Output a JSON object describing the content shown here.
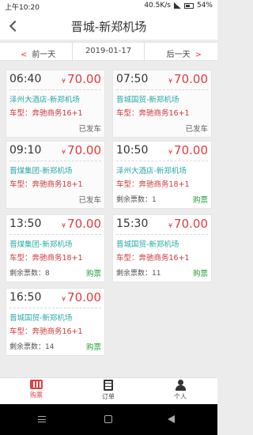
{
  "status_bar": {
    "time": "上午10:20",
    "network_speed": "40.5K/s",
    "battery": "54%"
  },
  "header": {
    "title": "晋城-新郑机场"
  },
  "date_nav": {
    "prev_label": "前一天",
    "current_date": "2019-01-17",
    "next_label": "后一天"
  },
  "trips": [
    {
      "time": "06:40",
      "currency": "¥",
      "price": "70.00",
      "route": "泽州大酒店-新郑机场",
      "model": "车型：奔驰商务16+1",
      "seats": "",
      "action": "已发车",
      "status": "departed"
    },
    {
      "time": "07:50",
      "currency": "¥",
      "price": "70.00",
      "route": "晋城国贸-新郑机场",
      "model": "车型：奔驰商务16+1",
      "seats": "",
      "action": "已发车",
      "status": "departed"
    },
    {
      "time": "09:10",
      "currency": "¥",
      "price": "70.00",
      "route": "晋煤集团-新郑机场",
      "model": "车型：奔驰商务18+1",
      "seats": "",
      "action": "已发车",
      "status": "departed"
    },
    {
      "time": "10:50",
      "currency": "¥",
      "price": "70.00",
      "route": "泽州大酒店-新郑机场",
      "model": "车型：奔驰商务18+1",
      "seats": "剩余票数：1",
      "action": "购票",
      "status": "buy"
    },
    {
      "time": "13:50",
      "currency": "¥",
      "price": "70.00",
      "route": "晋煤集团-新郑机场",
      "model": "车型：奔驰商务18+1",
      "seats": "剩余票数：8",
      "action": "购票",
      "status": "buy"
    },
    {
      "time": "15:30",
      "currency": "¥",
      "price": "70.00",
      "route": "晋城国贸-新郑机场",
      "model": "车型：奔驰商务16+1",
      "seats": "剩余票数：11",
      "action": "购票",
      "status": "buy"
    },
    {
      "time": "16:50",
      "currency": "¥",
      "price": "70.00",
      "route": "晋城国贸-新郑机场",
      "model": "车型：奔驰商务16+1",
      "seats": "剩余票数：14",
      "action": "购票",
      "status": "buy"
    }
  ],
  "tabs": [
    {
      "label": "购票",
      "icon": "ticket-icon",
      "active": true
    },
    {
      "label": "订单",
      "icon": "order-icon",
      "active": false
    },
    {
      "label": "个人",
      "icon": "user-icon",
      "active": false
    }
  ],
  "colors": {
    "accent": "#e04040",
    "route": "#2aa9a9",
    "buy": "#1f9e33"
  }
}
